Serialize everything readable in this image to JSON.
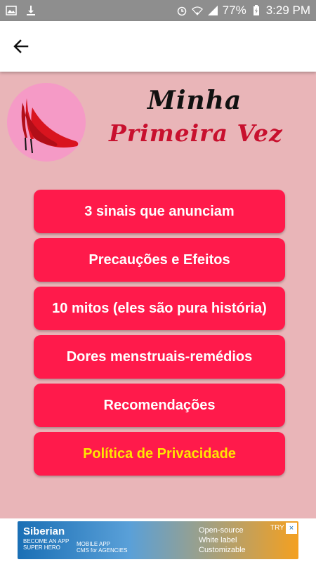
{
  "status_bar": {
    "battery": "77%",
    "time": "3:29 PM"
  },
  "header": {
    "back_label": "←"
  },
  "brand": {
    "line1": "Minha",
    "line2": "Primeira Vez"
  },
  "menu": {
    "items": [
      {
        "label": "3 sinais que anunciam"
      },
      {
        "label": "Precauções e Efeitos"
      },
      {
        "label": "10 mitos (eles são pura história)"
      },
      {
        "label": "Dores menstruais-remédios"
      },
      {
        "label": "Recomendações"
      },
      {
        "label": "Política de Privacidade"
      }
    ]
  },
  "ad": {
    "brand": "Siberian",
    "sub": "BECOME AN APP SUPER HERO",
    "left_lines": [
      "MOBILE APP",
      "CMS for AGENCIES"
    ],
    "right_lines": [
      "Open-source",
      "White label",
      "Customizable"
    ],
    "try": "TRY",
    "close": "×"
  },
  "colors": {
    "status": "#8e8e8e",
    "background": "#e9b5b8",
    "button": "#ff1a4b",
    "privacy_text": "#ffe600"
  }
}
